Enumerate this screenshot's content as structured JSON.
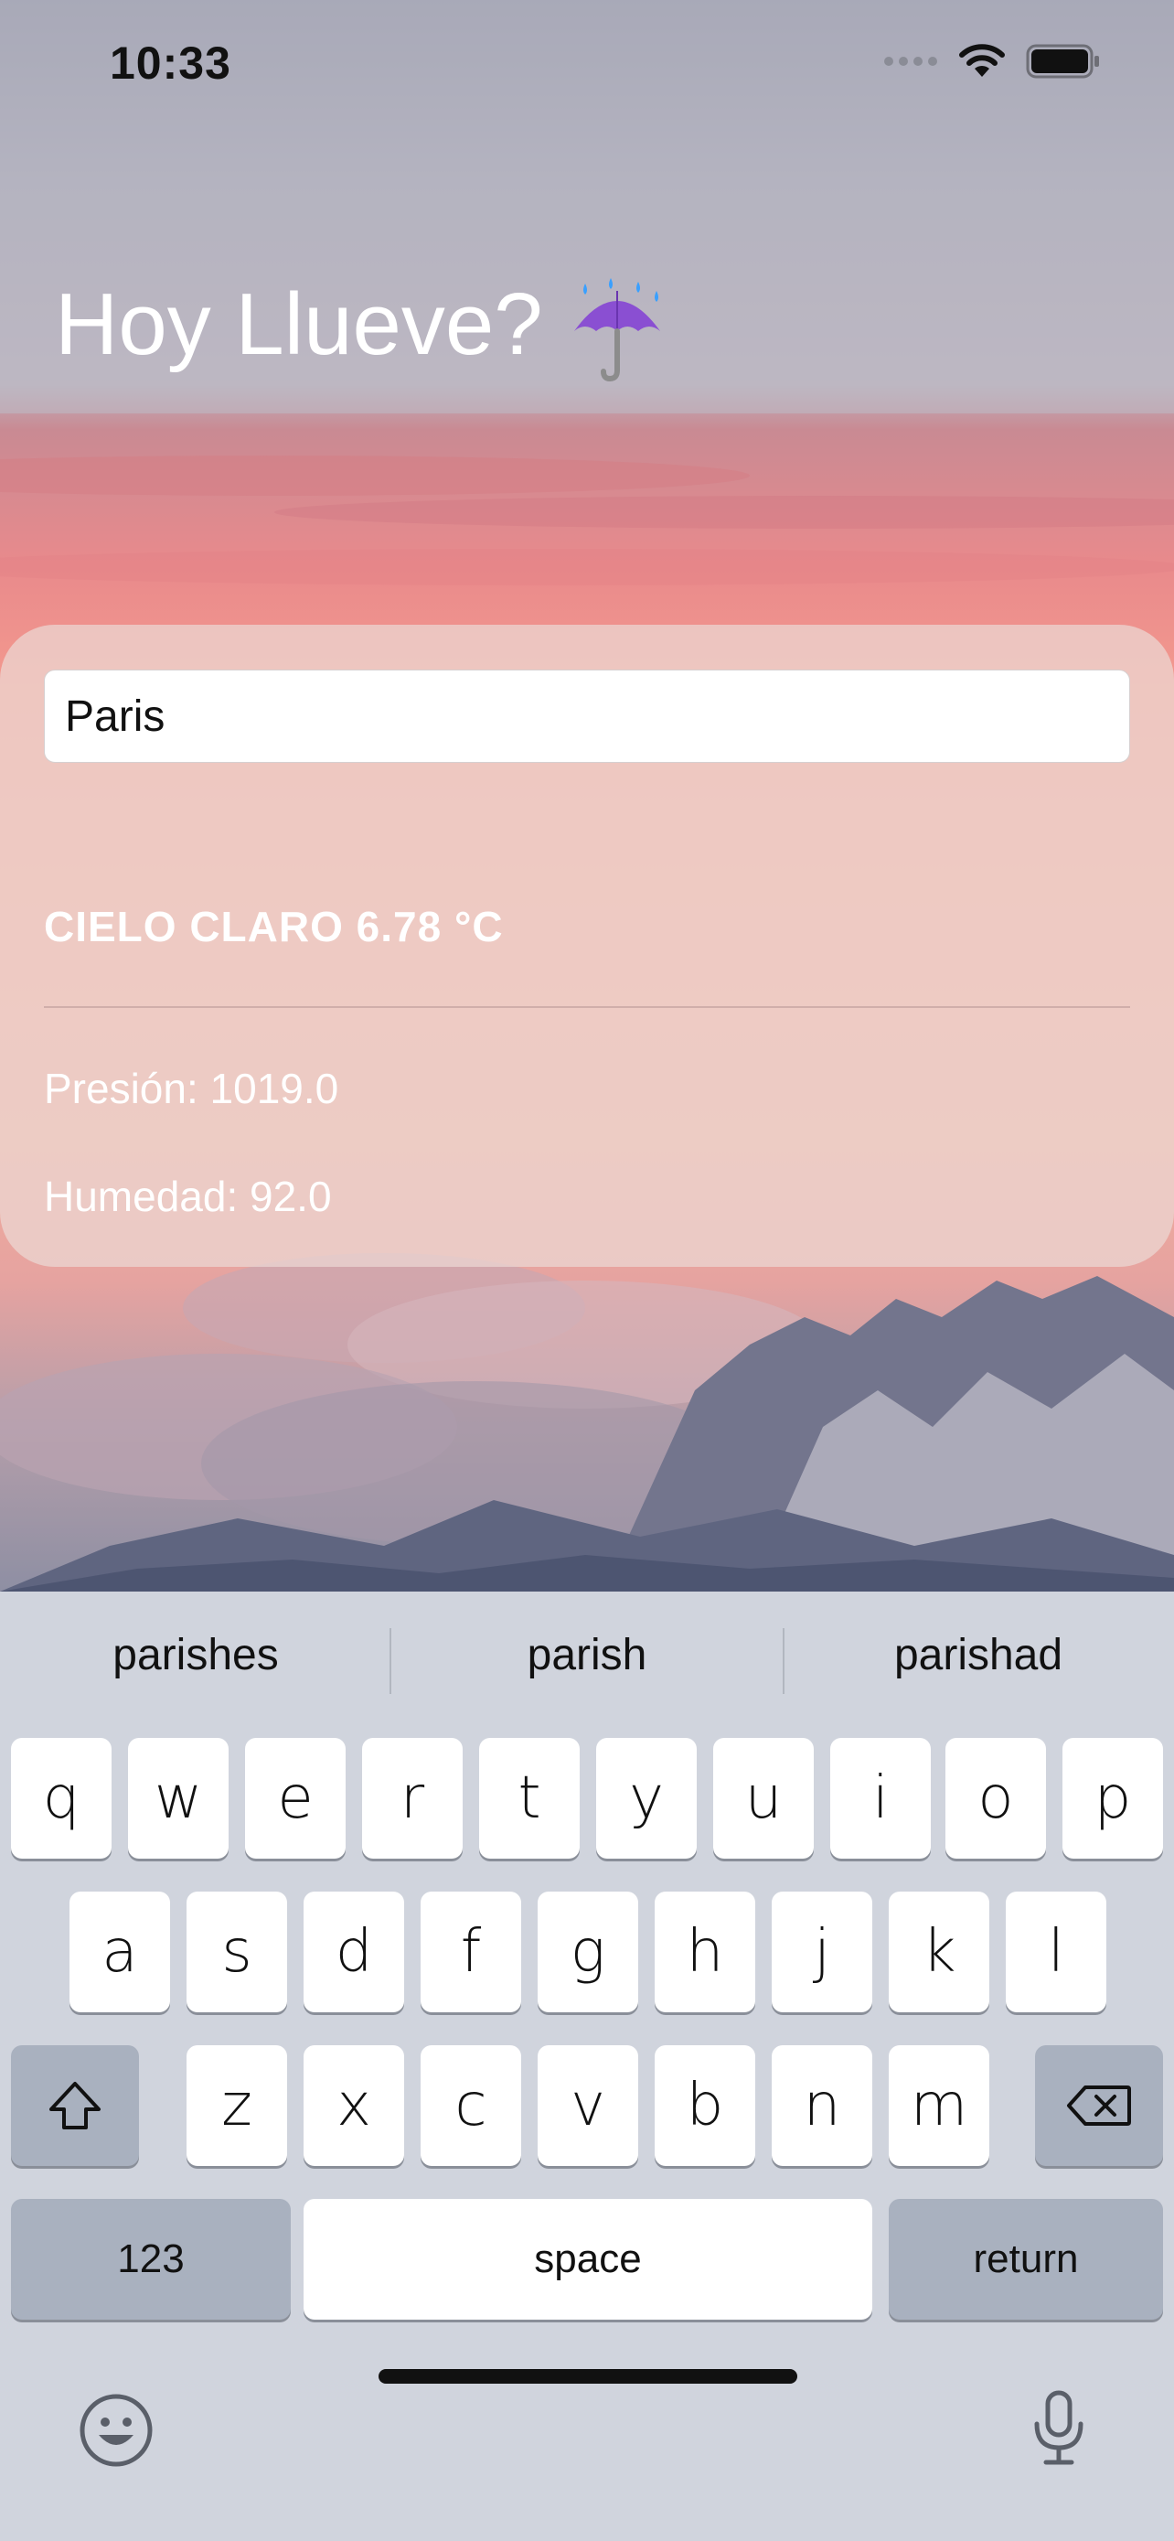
{
  "status_bar": {
    "time": "10:33",
    "icons": [
      "signal-dots-icon",
      "wifi-icon",
      "battery-icon"
    ]
  },
  "header": {
    "title": "Hoy Llueve?",
    "emoji_icon": "umbrella-with-rain-icon"
  },
  "weather_card": {
    "search": {
      "value": "Paris",
      "placeholder": ""
    },
    "condition": "CIELO CLARO 6.78 °C",
    "pressure": "Presión: 1019.0",
    "humidity": "Humedad: 92.0"
  },
  "keyboard": {
    "suggestions": [
      "parishes",
      "parish",
      "parishad"
    ],
    "row1": [
      "q",
      "w",
      "e",
      "r",
      "t",
      "y",
      "u",
      "i",
      "o",
      "p"
    ],
    "row2": [
      "a",
      "s",
      "d",
      "f",
      "g",
      "h",
      "j",
      "k",
      "l"
    ],
    "row3": [
      "z",
      "x",
      "c",
      "v",
      "b",
      "n",
      "m"
    ],
    "numbers_label": "123",
    "space_label": "space",
    "return_label": "return",
    "icons": [
      "shift-icon",
      "delete-icon",
      "emoji-icon",
      "microphone-icon"
    ]
  },
  "colors": {
    "title_text": "#ffffff",
    "keyboard_bg": "#d0d4dd",
    "key_bg": "#ffffff",
    "special_key_bg": "#a9b1bf"
  }
}
